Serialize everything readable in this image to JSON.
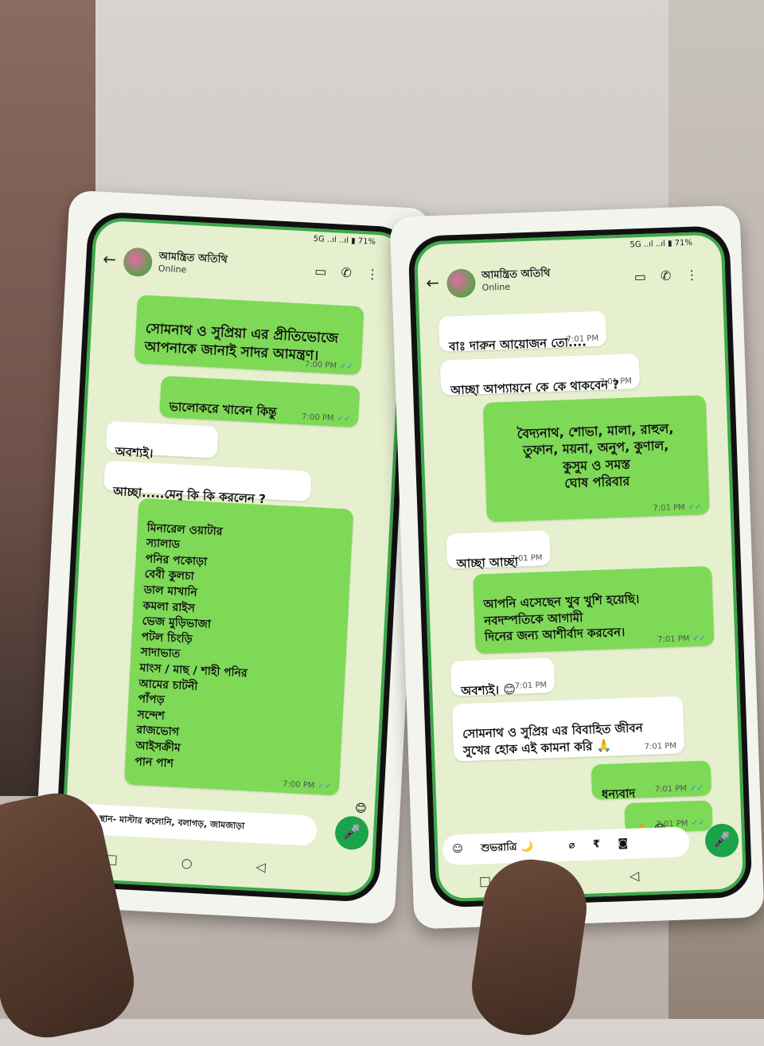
{
  "left_phone": {
    "status_right": "5G ..ıl ..ıl ▮ 71%",
    "contact_name": "আমন্ত্রিত অতিথি",
    "contact_status": "Online",
    "messages": [
      {
        "text": "সোমনাথ ও সুপ্রিয়া এর প্রীতিভোজে আপনাকে জানাই সাদর আমন্ত্রণ।",
        "time": "7:00 PM"
      },
      {
        "text": "ভালোকরে খাবেন কিন্তু",
        "time": "7:00 PM"
      },
      {
        "text": "অবশ্যই।",
        "time": ""
      },
      {
        "text": "আচ্ছা.....মেনু কি কি করলেন ?",
        "time": ""
      },
      {
        "text": "মিনারেল ওয়াটার\nস্যালাড\nপনির পকোড়া\nবেবী কুলচা\nডাল মাখানি\nকমলা রাইস\nভেজ মুড়িভাজা\nপটল চিংড়ি\nসাদাভাত\nমাংস / মাছ / শাহী পনির\nআমের চাটনী\nপাঁপড়\nসন্দেশ\nরাজভোগ\nআইসক্রীম\nপান পাশ",
        "time": "7:00 PM"
      }
    ],
    "input_text": "স্থান- মাস্টার কলোনি, বলাগড়, জামজাড়া"
  },
  "right_phone": {
    "status_right": "5G ..ıl ..ıl ▮ 71%",
    "contact_name": "আমন্ত্রিত অতিথি",
    "contact_status": "Online",
    "messages": [
      {
        "text": "বাঃ দারুন আয়োজন তো....",
        "time": "7:01 PM"
      },
      {
        "text": "আচ্ছা আপ্যায়নে কে কে থাকবেন ?",
        "time": "7:01 PM"
      },
      {
        "text": "বৈদ্যনাথ, শোভা, মালা, রাহুল,\nতুফান, ময়না, অনুপ, কুণাল,\nকুসুম ও সমস্ত\nঘোষ পরিবার",
        "time": "7:01 PM"
      },
      {
        "text": "আচ্ছা আচ্ছা",
        "time": "7:01 PM"
      },
      {
        "text": "আপনি এসেছেন খুব খুশি হয়েছি।\nনবদম্পতিকে আগামী\nদিনের জন্য আশীর্বাদ করবেন।",
        "time": "7:01 PM"
      },
      {
        "text": "অবশ্যই। 😊",
        "time": "7:01 PM"
      },
      {
        "text": "সোমনাথ ও সুপ্রিয় এর বিবাহিত জীবন\nসুখের হোক এই কামনা করি 🙏",
        "time": "7:01 PM"
      },
      {
        "text": "ধন্যবাদ",
        "time": "7:01 PM"
      },
      {
        "text": "🙏 😊",
        "time": "7:01 PM"
      }
    ],
    "input_text": "শুভরাত্রি 🌙"
  },
  "icons": [
    "back-arrow-icon",
    "video-call-icon",
    "phone-icon",
    "menu-dots-icon",
    "emoji-icon",
    "attach-icon",
    "rupee-icon",
    "camera-icon",
    "mic-icon",
    "square-nav-icon",
    "circle-nav-icon",
    "triangle-nav-icon"
  ]
}
